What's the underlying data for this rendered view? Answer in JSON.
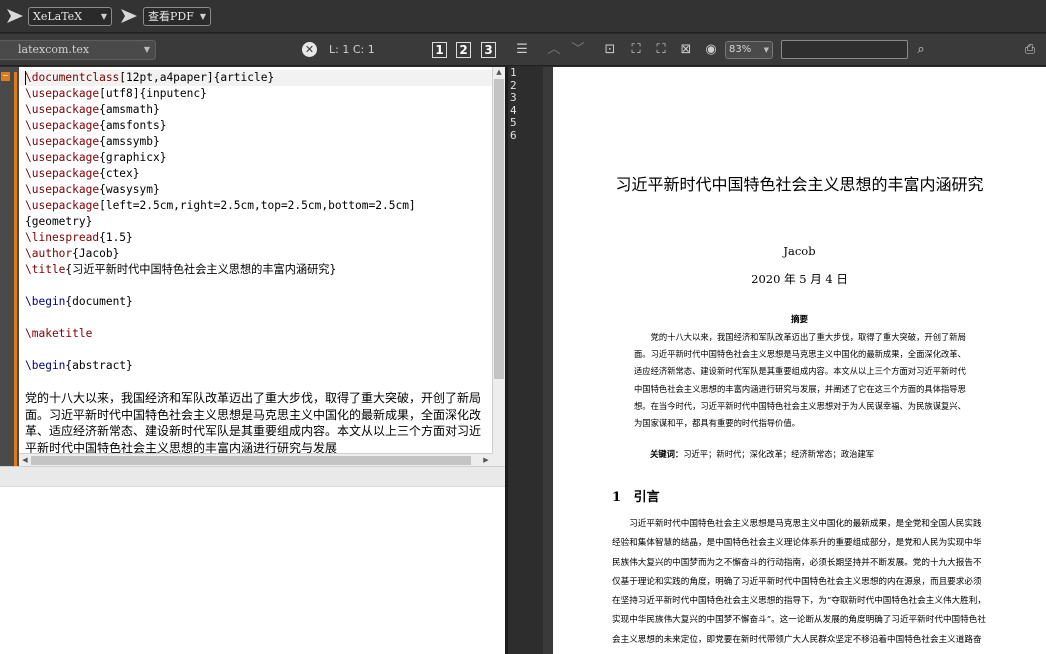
{
  "toolbar": {
    "compiler": "XeLaTeX",
    "viewer": "查看PDF"
  },
  "editor_bar": {
    "file": "latexcom.tex",
    "cursor_pos": "L: 1 C: 1",
    "layout_buttons": [
      "1",
      "2",
      "3"
    ],
    "zoom": "83%",
    "search_value": ""
  },
  "code_lines": [
    [
      [
        "kw",
        "\\documentclass"
      ],
      [
        "",
        "[12pt,a4paper]{article}"
      ]
    ],
    [
      [
        "kw",
        "\\usepackage"
      ],
      [
        "",
        "[utf8]{inputenc}"
      ]
    ],
    [
      [
        "kw",
        "\\usepackage"
      ],
      [
        "",
        "{amsmath}"
      ]
    ],
    [
      [
        "kw",
        "\\usepackage"
      ],
      [
        "",
        "{amsfonts}"
      ]
    ],
    [
      [
        "kw",
        "\\usepackage"
      ],
      [
        "",
        "{amssymb}"
      ]
    ],
    [
      [
        "kw",
        "\\usepackage"
      ],
      [
        "",
        "{graphicx}"
      ]
    ],
    [
      [
        "kw",
        "\\usepackage"
      ],
      [
        "",
        "{ctex}"
      ]
    ],
    [
      [
        "kw",
        "\\usepackage"
      ],
      [
        "",
        "{wasysym}"
      ]
    ],
    [
      [
        "kw",
        "\\usepackage"
      ],
      [
        "",
        "[left=2.5cm,right=2.5cm,top=2.5cm,bottom=2.5cm]"
      ]
    ],
    [
      [
        "",
        "{geometry}"
      ]
    ],
    [
      [
        "kw",
        "\\linespread"
      ],
      [
        "",
        "{1.5}"
      ]
    ],
    [
      [
        "kw",
        "\\author"
      ],
      [
        "",
        "{Jacob}"
      ]
    ],
    [
      [
        "kw",
        "\\title"
      ],
      [
        "",
        "{习近平新时代中国特色社会主义思想的丰富内涵研究}"
      ]
    ],
    [],
    [
      [
        "kw2",
        "\\begin"
      ],
      [
        "",
        "{document}"
      ]
    ],
    [],
    [
      [
        "kw",
        "\\maketitle"
      ]
    ],
    [],
    [
      [
        "kw2",
        "\\begin"
      ],
      [
        "",
        "{abstract}"
      ]
    ],
    []
  ],
  "editor_prose": "党的十八大以来，我国经济和军队改革迈出了重大步伐，取得了重大突破，开创了新局面。习近平新时代中国特色社会主义思想是马克思主义中国化的最新成果，全面深化改革、适应经济新常态、建设新时代军队是其重要组成内容。本文从以上三个方面对习近平新时代中国特色社会主义思想的丰富内涵进行研究与发展",
  "page_numbers": [
    "1",
    "2",
    "3",
    "4",
    "5",
    "6"
  ],
  "pdf": {
    "title": "习近平新时代中国特色社会主义思想的丰富内涵研究",
    "author": "Jacob",
    "date": "2020 年 5 月 4 日",
    "abstract_heading": "摘要",
    "abstract": "党的十八大以来，我国经济和军队改革迈出了重大步伐，取得了重大突破，开创了新局面。习近平新时代中国特色社会主义思想是马克思主义中国化的最新成果，全面深化改革、适应经济新常态、建设新时代军队是其重要组成内容。本文从以上三个方面对习近平新时代中国特色社会主义思想的丰富内涵进行研究与发展，并阐述了它在这三个方面的具体指导思想。在当今时代，习近平新时代中国特色社会主义思想对于为人民谋幸福、为民族谋复兴、为国家谋和平，都具有重要的时代指导价值。",
    "keywords_label": "关键词：",
    "keywords": "习近平；新时代；深化改革；经济新常态；政治建军",
    "section_number": "1",
    "section_title": "引言",
    "section_body": "习近平新时代中国特色社会主义思想是马克思主义中国化的最新成果，是全党和全国人民实践经验和集体智慧的结晶，是中国特色社会主义理论体系升的重要组成部分，是党和人民为实现中华民族伟大复兴的中国梦而为之不懈奋斗的行动指南，必须长期坚持并不断发展。党的十九大报告不仅基于理论和实践的角度，明确了习近平新时代中国特色社会主义思想的内在源泉，而且要求必须在坚持习近平新时代中国特色社会主义思想的指导下，为“夺取新时代中国特色社会主义伟大胜利，实现中华民族伟大复兴的中国梦不懈奋斗”。这一论断从发展的角度明确了习近平新时代中国特色社会主义思想的未来定位，即党要在新时代带领广大人民群众坚定不移沿着中国特色社会主义道路奋勇"
  }
}
